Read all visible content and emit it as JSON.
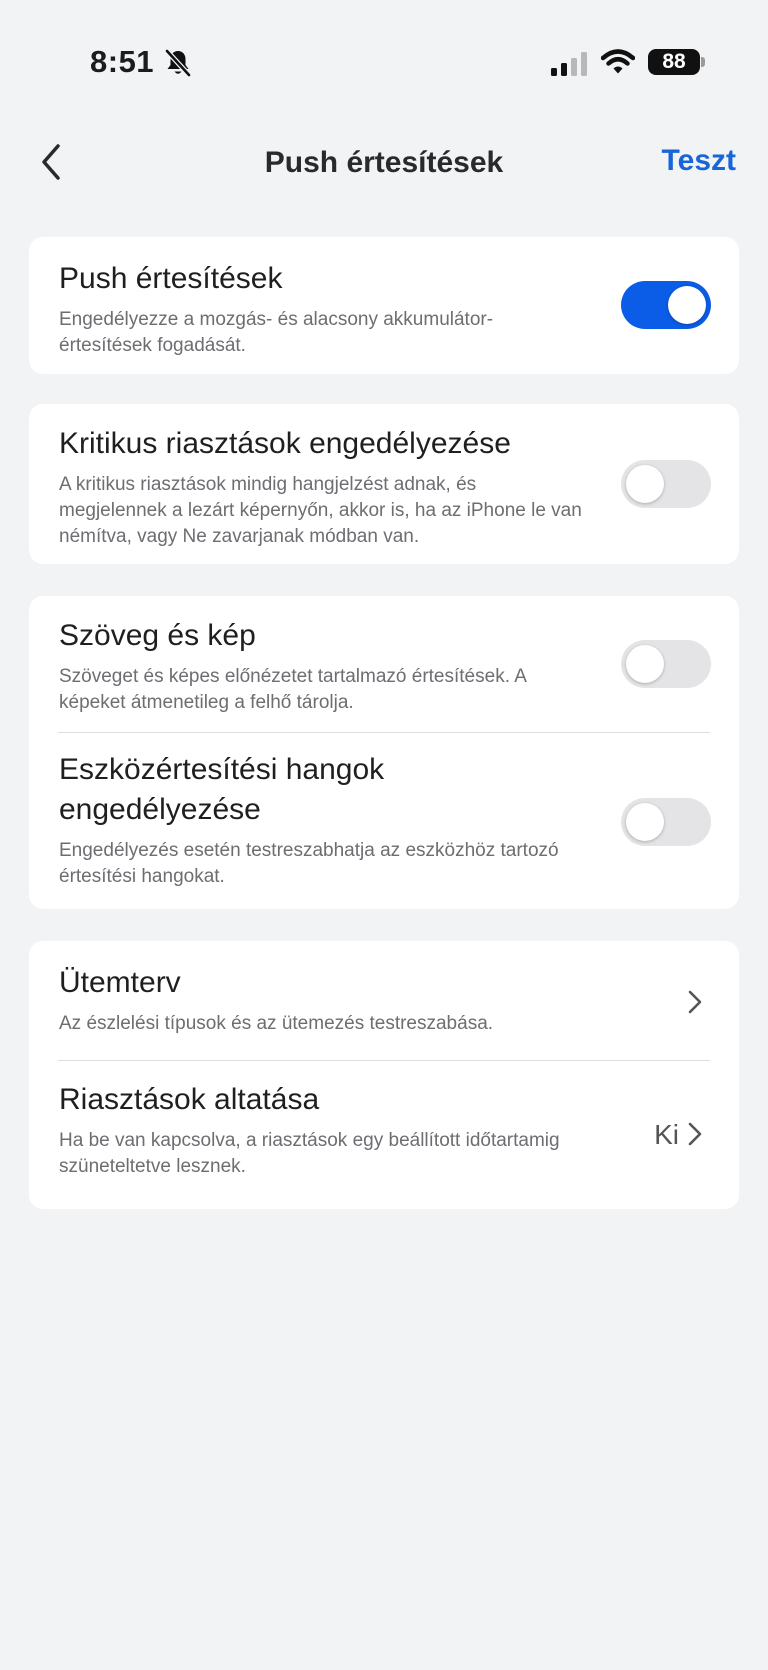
{
  "status_bar": {
    "time": "8:51",
    "battery": "88",
    "icons": [
      "bell-slash-icon",
      "cellular-signal-icon",
      "wifi-icon",
      "battery-icon"
    ]
  },
  "nav": {
    "back_icon": "chevron-left-icon",
    "title": "Push értesítések",
    "action_label": "Teszt",
    "accent_color": "#1765d8"
  },
  "settings": {
    "push": {
      "title": "Push értesítések",
      "description": "Engedélyezze a mozgás- és alacsony akkumulátor-értesítések fogadását.",
      "enabled": true
    },
    "critical": {
      "title": "Kritikus riasztások engedélyezése",
      "description": "A kritikus riasztások mindig hangjelzést adnak, és megjelennek a lezárt képernyőn, akkor is, ha az iPhone le van némítva, vagy Ne zavarjanak módban van.",
      "enabled": false
    },
    "text_image": {
      "title": "Szöveg és kép",
      "description": "Szöveget és képes előnézetet tartalmazó értesítések. A képeket átmenetileg a felhő tárolja.",
      "enabled": false
    },
    "device_sounds": {
      "title": "Eszközértesítési hangok engedélyezése",
      "description": "Engedélyezés esetén testreszabhatja az eszközhöz tartozó értesítési hangokat.",
      "enabled": false
    },
    "schedule": {
      "title": "Ütemterv",
      "description": "Az észlelési típusok és az ütemezés testreszabása."
    },
    "snooze": {
      "title": "Riasztások altatása",
      "description": "Ha be van kapcsolva, a riasztások egy beállított időtartamig szüneteltetve lesznek.",
      "value": "Ki"
    }
  },
  "colors": {
    "toggle_on": "#0b5ce6",
    "toggle_off": "#e4e4e7",
    "background": "#f2f3f5"
  }
}
